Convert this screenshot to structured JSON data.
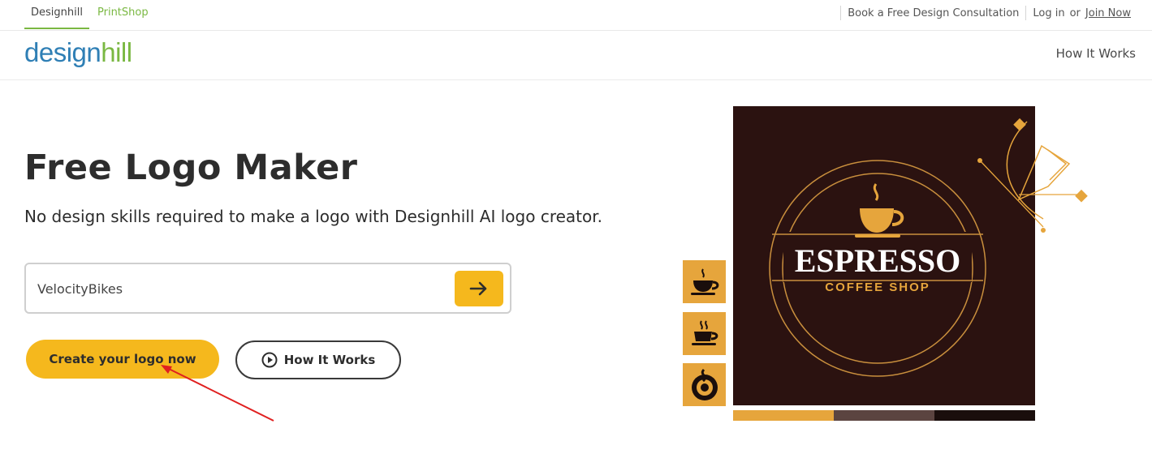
{
  "topbar": {
    "tab_designhill": "Designhill",
    "tab_printshop": "PrintShop",
    "consultation": "Book a Free Design Consultation",
    "login": "Log in",
    "or": "or",
    "join": "Join Now"
  },
  "header": {
    "logo_part1": "design",
    "logo_part2": "hill",
    "nav_how_it_works": "How It Works"
  },
  "hero": {
    "title": "Free Logo Maker",
    "subtitle": "No design skills required to make a logo with Designhill AI logo creator.",
    "search_value": "VelocityBikes",
    "create_button": "Create your logo now",
    "how_button": "How It Works"
  },
  "showcase": {
    "brand": "ESPRESSO",
    "tagline": "COFFEE SHOP",
    "swatches": [
      "#e6a53c",
      "#5b4440",
      "#1a0e0c"
    ]
  },
  "colors": {
    "accent_yellow": "#f5b81d",
    "brand_blue": "#2f7fb5",
    "brand_green": "#7ab842",
    "annotation_red": "#e02020"
  }
}
